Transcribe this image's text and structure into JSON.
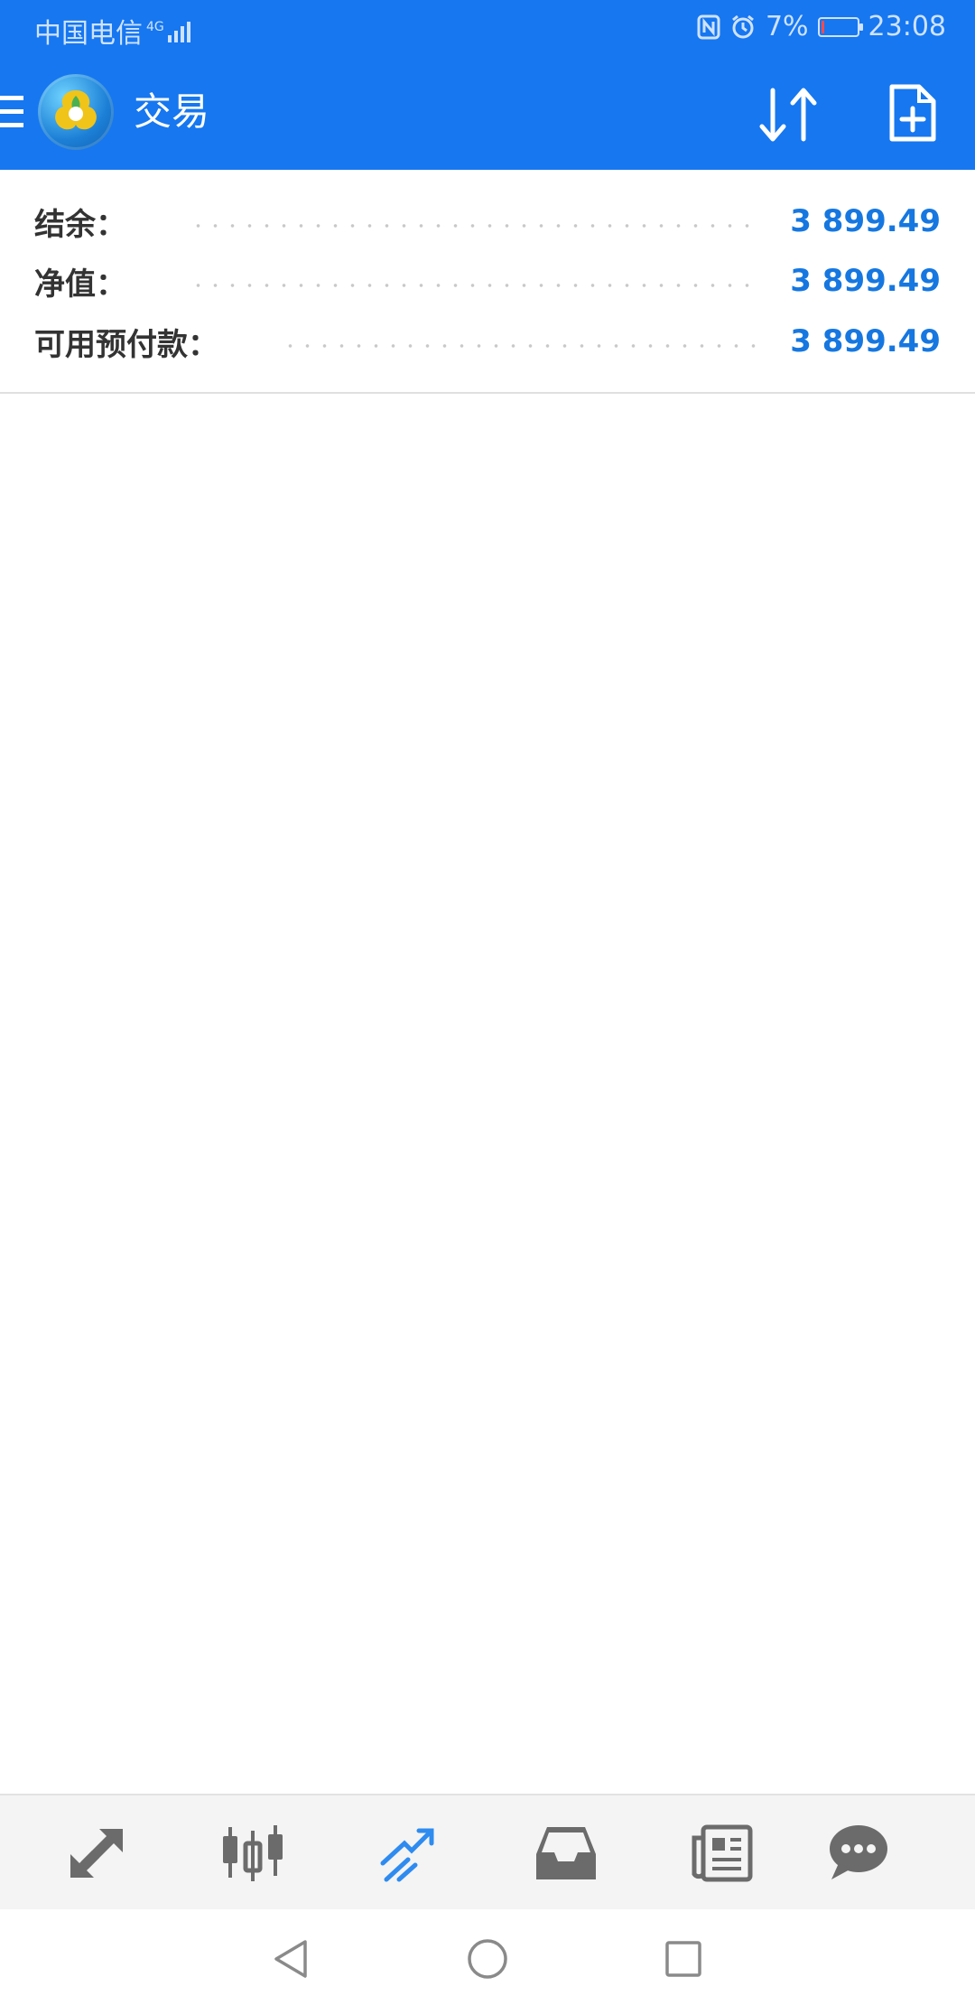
{
  "status_bar": {
    "carrier": "中国电信",
    "network": "4G",
    "battery": "7%",
    "battery_level": 0.07,
    "time": "23:08"
  },
  "app_bar": {
    "title": "交易",
    "icons": [
      "menu-icon",
      "sort-icon",
      "new-order-icon"
    ]
  },
  "summary": {
    "rows": [
      {
        "label": "结余：",
        "value": "3 899.49"
      },
      {
        "label": "净值：",
        "value": "3 899.49"
      },
      {
        "label": "可用预付款：",
        "value": "3 899.49"
      }
    ]
  },
  "tabs": [
    {
      "icon": "quotes-icon",
      "active": false
    },
    {
      "icon": "chart-icon",
      "active": false
    },
    {
      "icon": "trade-icon",
      "active": true
    },
    {
      "icon": "history-icon",
      "active": false
    },
    {
      "icon": "news-icon",
      "active": false
    },
    {
      "icon": "chat-icon",
      "active": false
    }
  ],
  "colors": {
    "accent": "#1677f0",
    "value": "#1677e0",
    "tab_inactive": "#6b6b6b",
    "tab_active": "#2e8bf0"
  }
}
